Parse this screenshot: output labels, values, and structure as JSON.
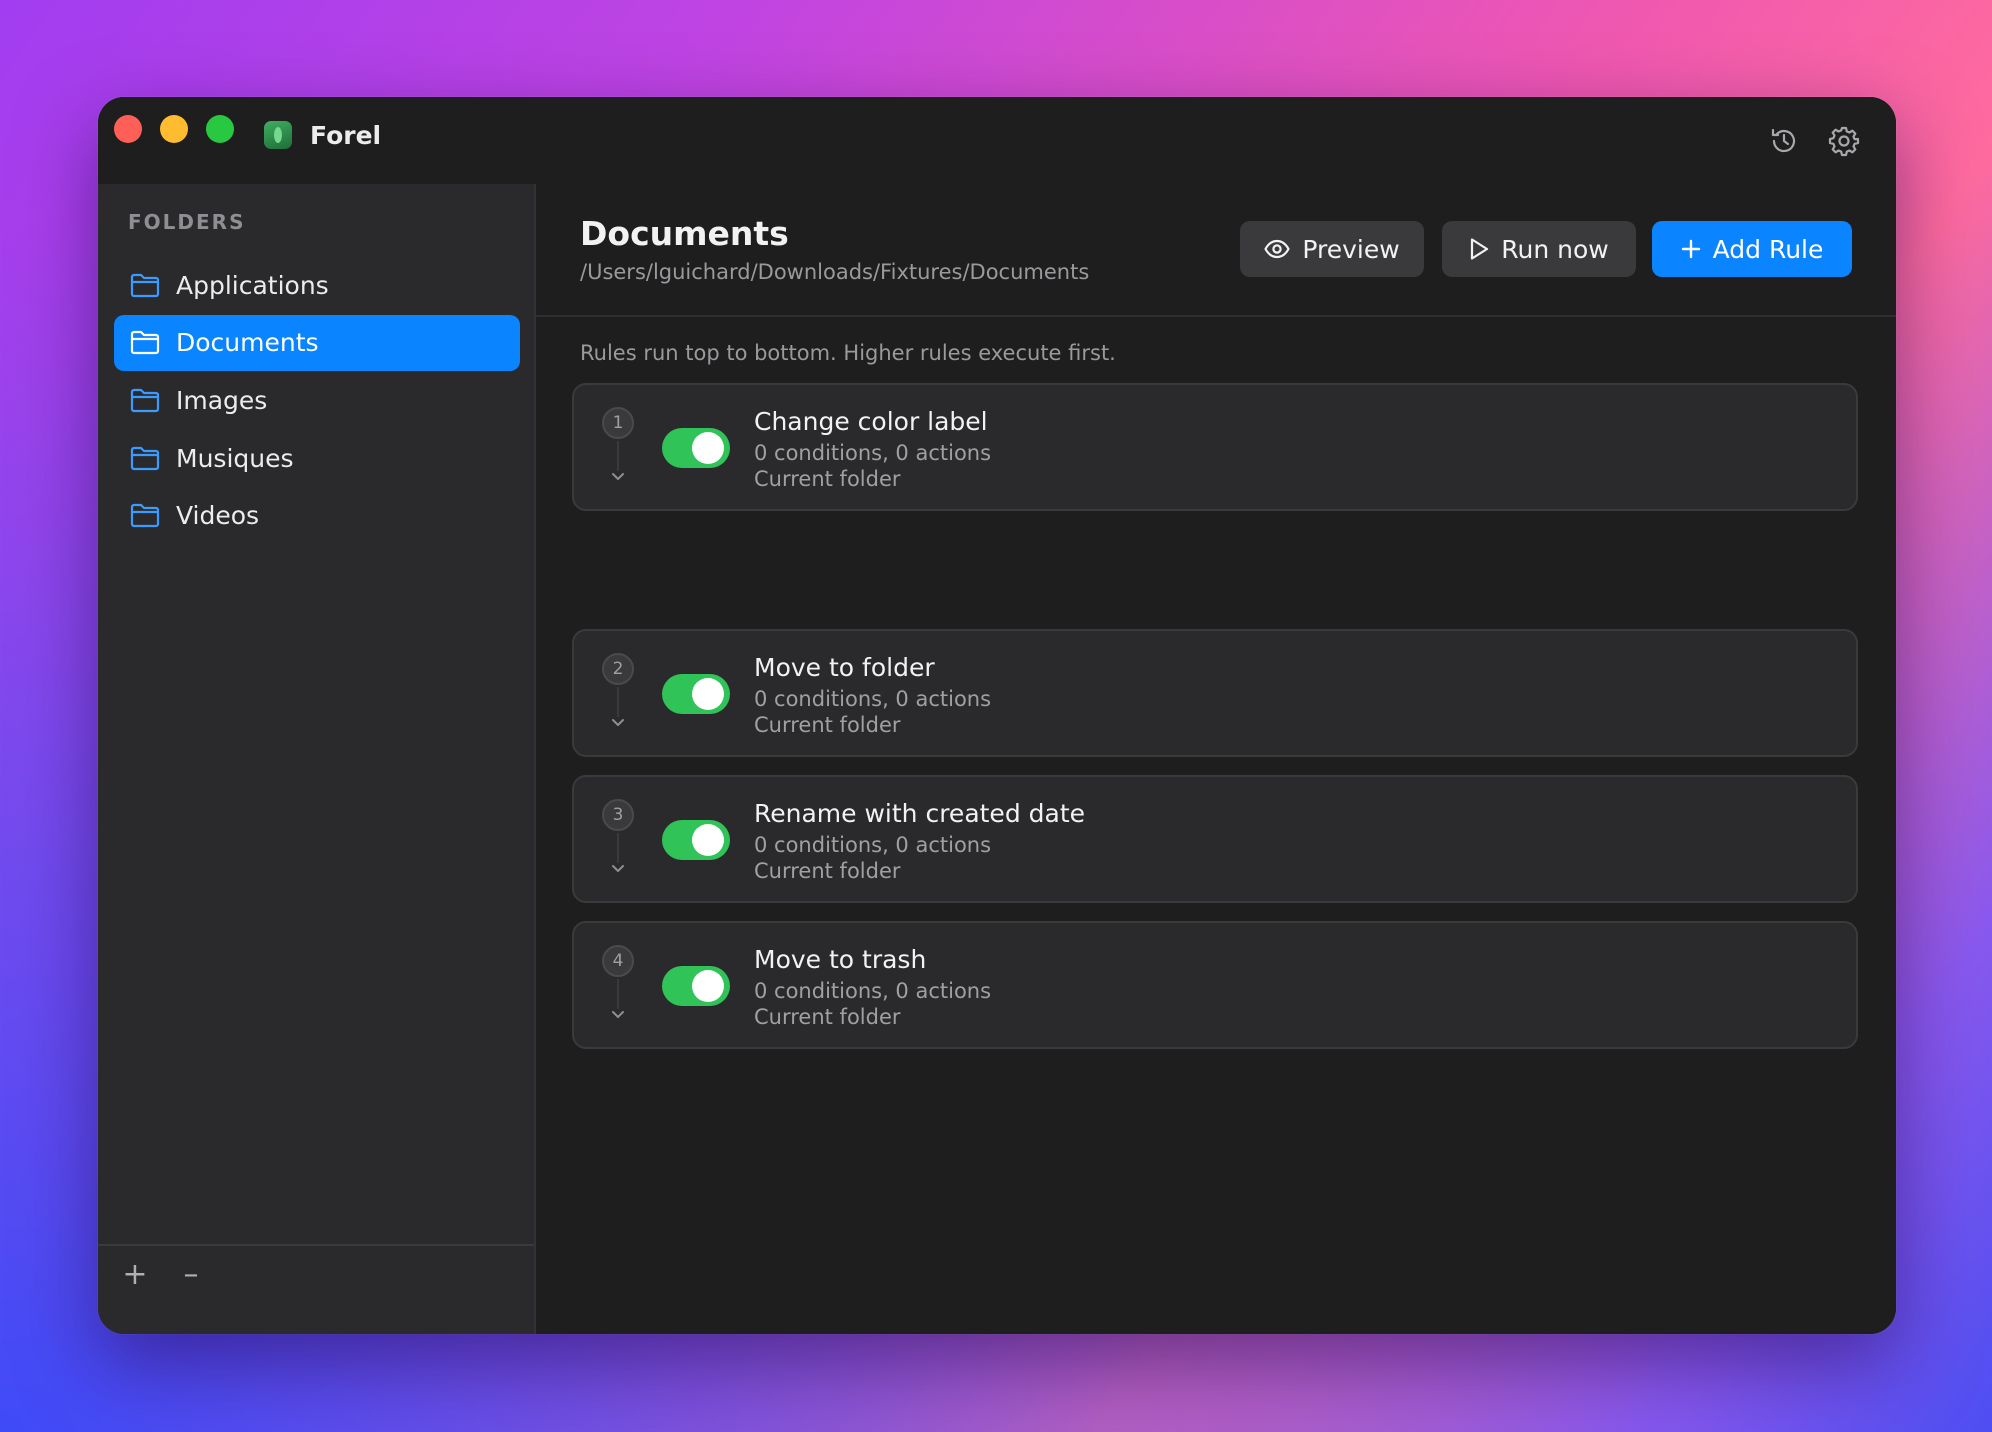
{
  "app": {
    "title": "Forel",
    "icons": [
      "history-icon",
      "gear-icon"
    ]
  },
  "sidebar": {
    "heading": "FOLDERS",
    "items": [
      {
        "label": "Applications",
        "selected": false
      },
      {
        "label": "Documents",
        "selected": true
      },
      {
        "label": "Images",
        "selected": false
      },
      {
        "label": "Musiques",
        "selected": false
      },
      {
        "label": "Videos",
        "selected": false
      }
    ],
    "add_label": "+",
    "remove_label": "–"
  },
  "main": {
    "title": "Documents",
    "path": "/Users/lguichard/Downloads/Fixtures/Documents",
    "buttons": {
      "preview": "Preview",
      "run_now": "Run now",
      "add_rule": "Add Rule"
    },
    "hint": "Rules run top to bottom. Higher rules execute first.",
    "rules": [
      {
        "number": "1",
        "title": "Change color label",
        "summary": "0 conditions, 0 actions",
        "scope": "Current folder",
        "enabled": true
      },
      {
        "number": "2",
        "title": "Move to folder",
        "summary": "0 conditions, 0 actions",
        "scope": "Current folder",
        "enabled": true
      },
      {
        "number": "3",
        "title": "Rename with created date",
        "summary": "0 conditions, 0 actions",
        "scope": "Current folder",
        "enabled": true
      },
      {
        "number": "4",
        "title": "Move to trash",
        "summary": "0 conditions, 0 actions",
        "scope": "Current folder",
        "enabled": true
      }
    ]
  },
  "colors": {
    "accent": "#0a84ff",
    "toggle_on": "#30c358"
  }
}
